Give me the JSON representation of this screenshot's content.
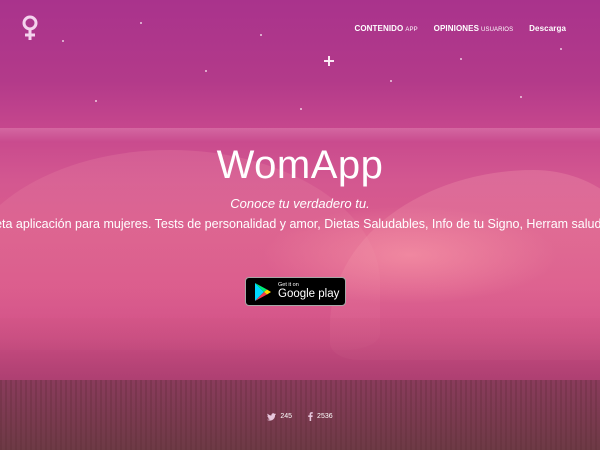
{
  "logo": {
    "icon": "female-symbol-icon"
  },
  "nav": {
    "items": [
      {
        "label": "CONTENIDO",
        "sub": "APP"
      },
      {
        "label": "OPINIONES",
        "sub": "USUARIOS"
      },
      {
        "label": "Descarga",
        "sub": ""
      }
    ]
  },
  "hero": {
    "title": "WomApp",
    "tagline": "Conoce tu verdadero tu.",
    "description": "eta aplicación para mujeres. Tests de personalidad y amor, Dietas Saludables, Info de tu Signo, Herram salud."
  },
  "play_badge": {
    "small_text": "Get it on",
    "large_text": "Google play",
    "icon": "google-play-icon"
  },
  "social": {
    "twitter": {
      "count": "245",
      "icon": "twitter-icon"
    },
    "facebook": {
      "count": "2536",
      "icon": "facebook-icon"
    }
  },
  "colors": {
    "overlay_top": "#a9338c",
    "overlay_mid": "#da5c8c",
    "text": "#ffffff",
    "badge_bg": "#000000"
  }
}
